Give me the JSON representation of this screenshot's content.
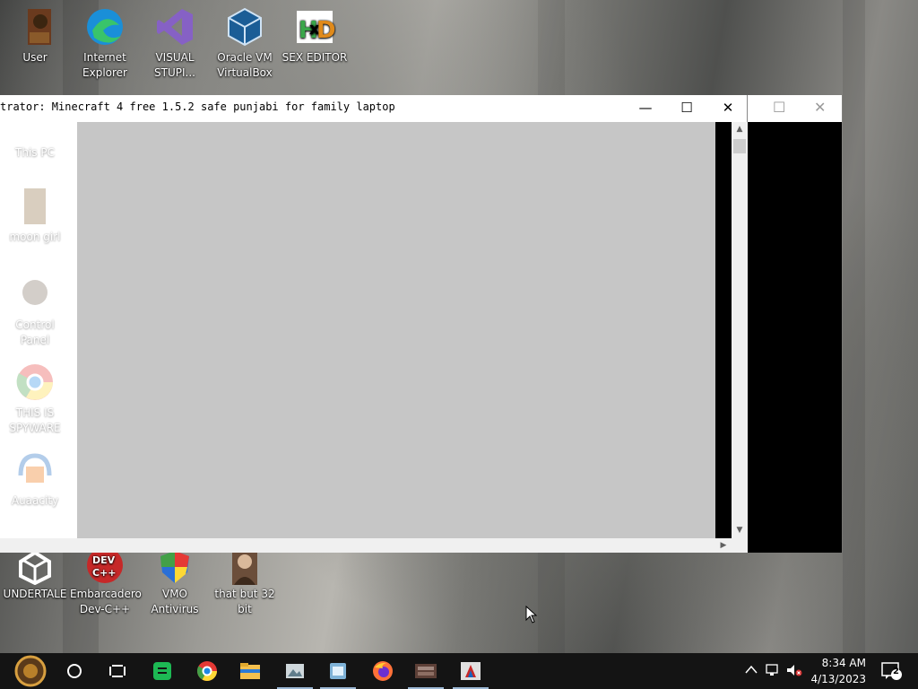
{
  "desktop_icons_top": [
    {
      "label": "User",
      "icon": "user-folder-icon"
    },
    {
      "label": "Internet Explorer",
      "icon": "edge-icon"
    },
    {
      "label": "VISUAL STUPI...",
      "icon": "visual-studio-icon"
    },
    {
      "label": "Oracle VM VirtualBox",
      "icon": "virtualbox-icon"
    },
    {
      "label": "SEX EDITOR",
      "icon": "hex-editor-icon"
    }
  ],
  "desktop_icons_left": [
    {
      "label": "This PC",
      "icon": "this-pc-icon"
    },
    {
      "label": "moon girl",
      "icon": "moon-girl-icon"
    },
    {
      "label": "Control Panel",
      "icon": "control-panel-icon"
    },
    {
      "label": "THIS IS SPYWARE",
      "icon": "chrome-icon"
    },
    {
      "label": "Auaacity",
      "icon": "audacity-icon"
    }
  ],
  "desktop_icons_bottom": [
    {
      "label": "UNDERTALE",
      "icon": "unity-icon"
    },
    {
      "label": "Embarcadero Dev-C++",
      "icon": "devcpp-icon"
    },
    {
      "label": "VMO Antivirus",
      "icon": "antivirus-shield-icon"
    },
    {
      "label": "that but 32 bit",
      "icon": "portrait-icon"
    }
  ],
  "main_window": {
    "title": "trator:  Minecraft 4 free 1.5.2 safe punjabi for family laptop",
    "minimize": "—",
    "maximize": "☐",
    "close": "✕"
  },
  "taskbar": {
    "time": "8:34 AM",
    "date": "4/13/2023",
    "notification_count": "2",
    "items": [
      {
        "name": "start-button-icon"
      },
      {
        "name": "search-circle-icon"
      },
      {
        "name": "task-view-icon"
      },
      {
        "name": "green-app-icon"
      },
      {
        "name": "chrome-icon"
      },
      {
        "name": "file-explorer-icon"
      },
      {
        "name": "image-app-icon"
      },
      {
        "name": "notepad-app-icon"
      },
      {
        "name": "firefox-icon"
      },
      {
        "name": "game-app-icon"
      },
      {
        "name": "java-app-icon"
      }
    ]
  },
  "colors": {
    "game_bg": "#c6c6c6",
    "taskbar": "#141414"
  }
}
